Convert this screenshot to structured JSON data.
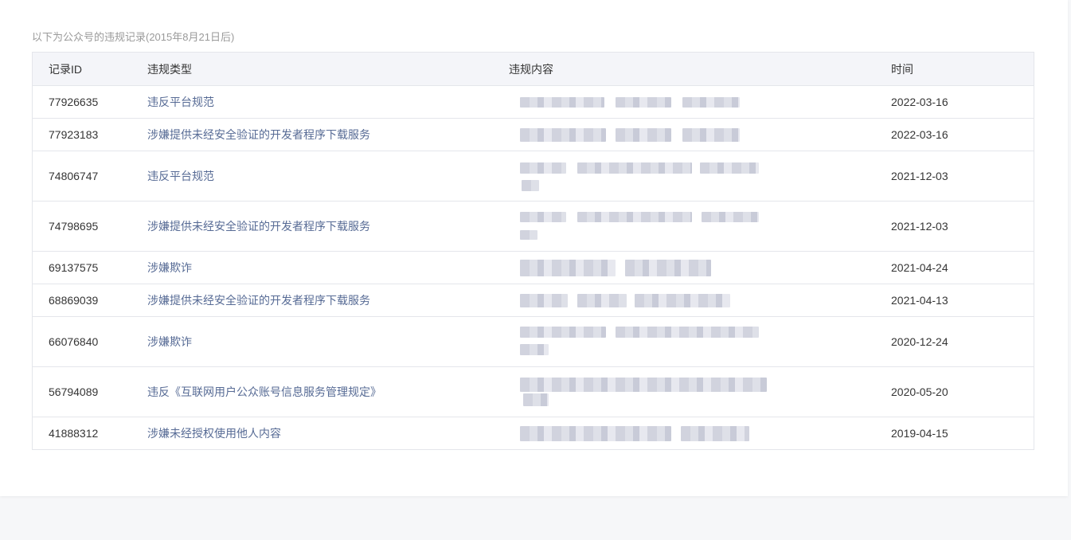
{
  "notice": "以下为公众号的违规记录(2015年8月21日后)",
  "table": {
    "headers": {
      "id": "记录ID",
      "type": "违规类型",
      "content": "违规内容",
      "time": "时间"
    },
    "rows": [
      {
        "id": "77926635",
        "type": "违反平台规范",
        "time": "2022-03-16"
      },
      {
        "id": "77923183",
        "type": "涉嫌提供未经安全验证的开发者程序下载服务",
        "time": "2022-03-16"
      },
      {
        "id": "74806747",
        "type": "违反平台规范",
        "time": "2021-12-03"
      },
      {
        "id": "74798695",
        "type": "涉嫌提供未经安全验证的开发者程序下载服务",
        "time": "2021-12-03"
      },
      {
        "id": "69137575",
        "type": "涉嫌欺诈",
        "time": "2021-04-24"
      },
      {
        "id": "68869039",
        "type": "涉嫌提供未经安全验证的开发者程序下载服务",
        "time": "2021-04-13"
      },
      {
        "id": "66076840",
        "type": "涉嫌欺诈",
        "time": "2020-12-24"
      },
      {
        "id": "56794089",
        "type": "违反《互联网用户公众账号信息服务管理规定》",
        "time": "2020-05-20"
      },
      {
        "id": "41888312",
        "type": "涉嫌未经授权使用他人内容",
        "time": "2019-04-15"
      }
    ]
  },
  "colors": {
    "link": "#576b95",
    "header_bg": "#f4f5f9",
    "border": "#e4e6eb",
    "page_bg": "#f6f7f9"
  }
}
